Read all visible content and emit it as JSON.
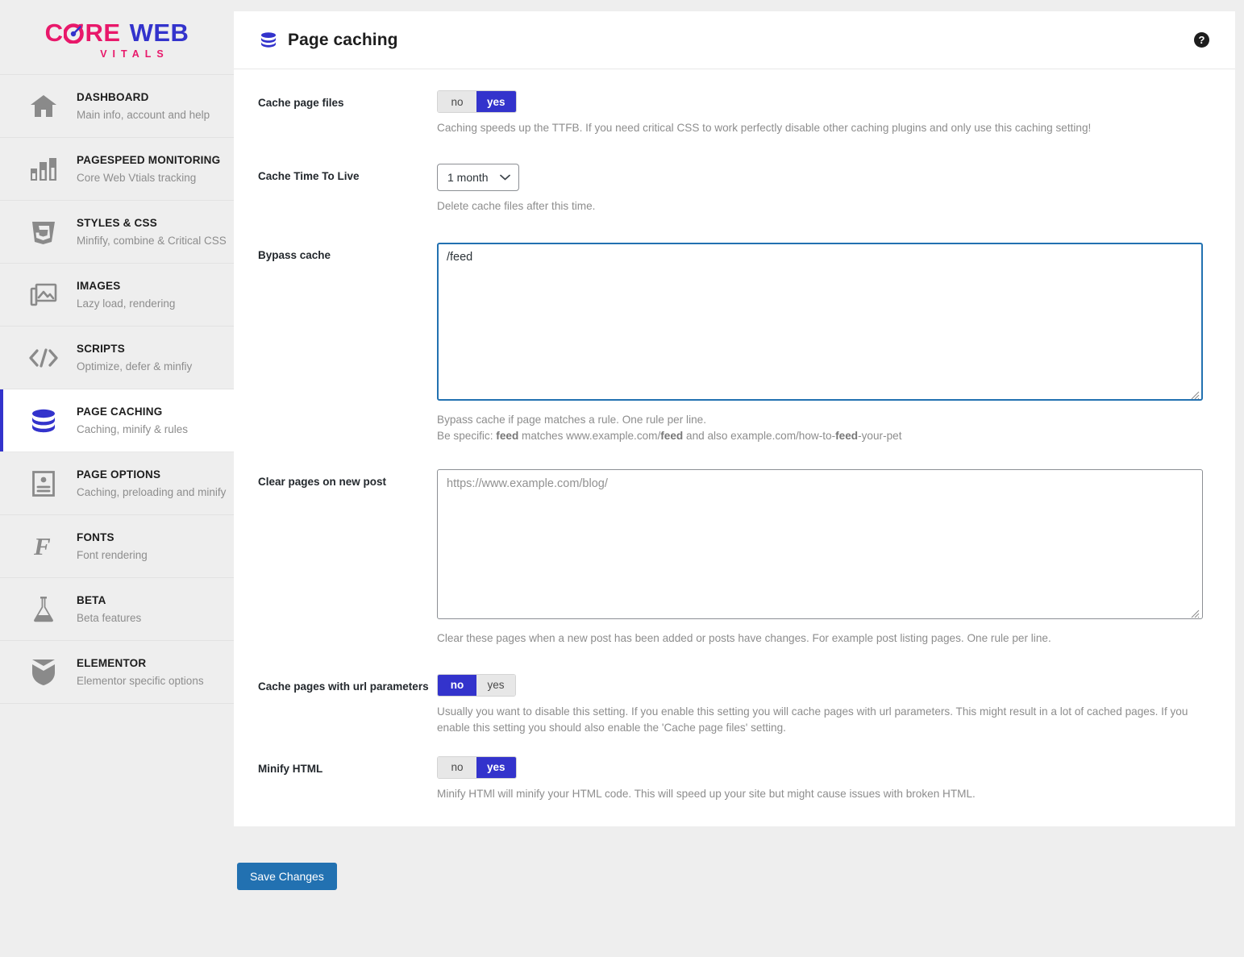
{
  "brand": {
    "logo_core": "C RE",
    "logo_core_pre": "C",
    "logo_core_post": "RE",
    "logo_web": "WEB",
    "logo_sub": "VITALS",
    "color_pink": "#e8186a",
    "color_blue": "#3333cc"
  },
  "sidebar": {
    "items": [
      {
        "title": "DASHBOARD",
        "sub": "Main info, account and help",
        "icon": "home-icon",
        "active": false
      },
      {
        "title": "PAGESPEED MONITORING",
        "sub": "Core Web Vtials tracking",
        "icon": "bar-chart-icon",
        "active": false
      },
      {
        "title": "STYLES & CSS",
        "sub": "Minfify, combine & Critical CSS",
        "icon": "css3-icon",
        "active": false
      },
      {
        "title": "IMAGES",
        "sub": "Lazy load, rendering",
        "icon": "images-icon",
        "active": false
      },
      {
        "title": "SCRIPTS",
        "sub": "Optimize, defer & minfiy",
        "icon": "code-icon",
        "active": false
      },
      {
        "title": "PAGE CACHING",
        "sub": "Caching, minify & rules",
        "icon": "database-icon",
        "active": true
      },
      {
        "title": "PAGE OPTIONS",
        "sub": "Caching, preloading and minify",
        "icon": "page-icon",
        "active": false
      },
      {
        "title": "FONTS",
        "sub": "Font rendering",
        "icon": "font-icon",
        "active": false
      },
      {
        "title": "BETA",
        "sub": "Beta features",
        "icon": "flask-icon",
        "active": false
      },
      {
        "title": "ELEMENTOR",
        "sub": "Elementor specific options",
        "icon": "shield-icon",
        "active": false
      }
    ]
  },
  "header": {
    "title": "Page caching",
    "icon": "database-icon",
    "help_icon": "help-circle-icon"
  },
  "settings": {
    "cache_page_files": {
      "label": "Cache page files",
      "option_no": "no",
      "option_yes": "yes",
      "value": "yes",
      "helper": "Caching speeds up the TTFB. If you need critical CSS to work perfectly disable other caching plugins and only use this caching setting!"
    },
    "cache_ttl": {
      "label": "Cache Time To Live",
      "value": "1 month",
      "options": [
        "1 month"
      ],
      "helper": "Delete cache files after this time."
    },
    "bypass_cache": {
      "label": "Bypass cache",
      "value": "/feed",
      "placeholder": "",
      "helper_line1": "Bypass cache if page matches a rule. One rule per line.",
      "helper_line2_a": "Be specific: ",
      "helper_line2_b": "feed",
      "helper_line2_c": " matches www.example.com/",
      "helper_line2_d": "feed",
      "helper_line2_e": " and also example.com/how-to-",
      "helper_line2_f": "feed",
      "helper_line2_g": "-your-pet"
    },
    "clear_pages": {
      "label": "Clear pages on new post",
      "value": "",
      "placeholder": "https://www.example.com/blog/",
      "helper": "Clear these pages when a new post has been added or posts have changes. For example post listing pages. One rule per line."
    },
    "cache_url_params": {
      "label": "Cache pages with url parameters",
      "option_no": "no",
      "option_yes": "yes",
      "value": "no",
      "helper": "Usually you want to disable this setting. If you enable this setting you will cache pages with url parameters. This might result in a lot of cached pages. If you enable this setting you should also enable the 'Cache page files' setting."
    },
    "minify_html": {
      "label": "Minify HTML",
      "option_no": "no",
      "option_yes": "yes",
      "value": "yes",
      "helper": "Minify HTMl will minify your HTML code. This will speed up your site but might cause issues with broken HTML."
    }
  },
  "footer": {
    "save_label": "Save Changes"
  }
}
